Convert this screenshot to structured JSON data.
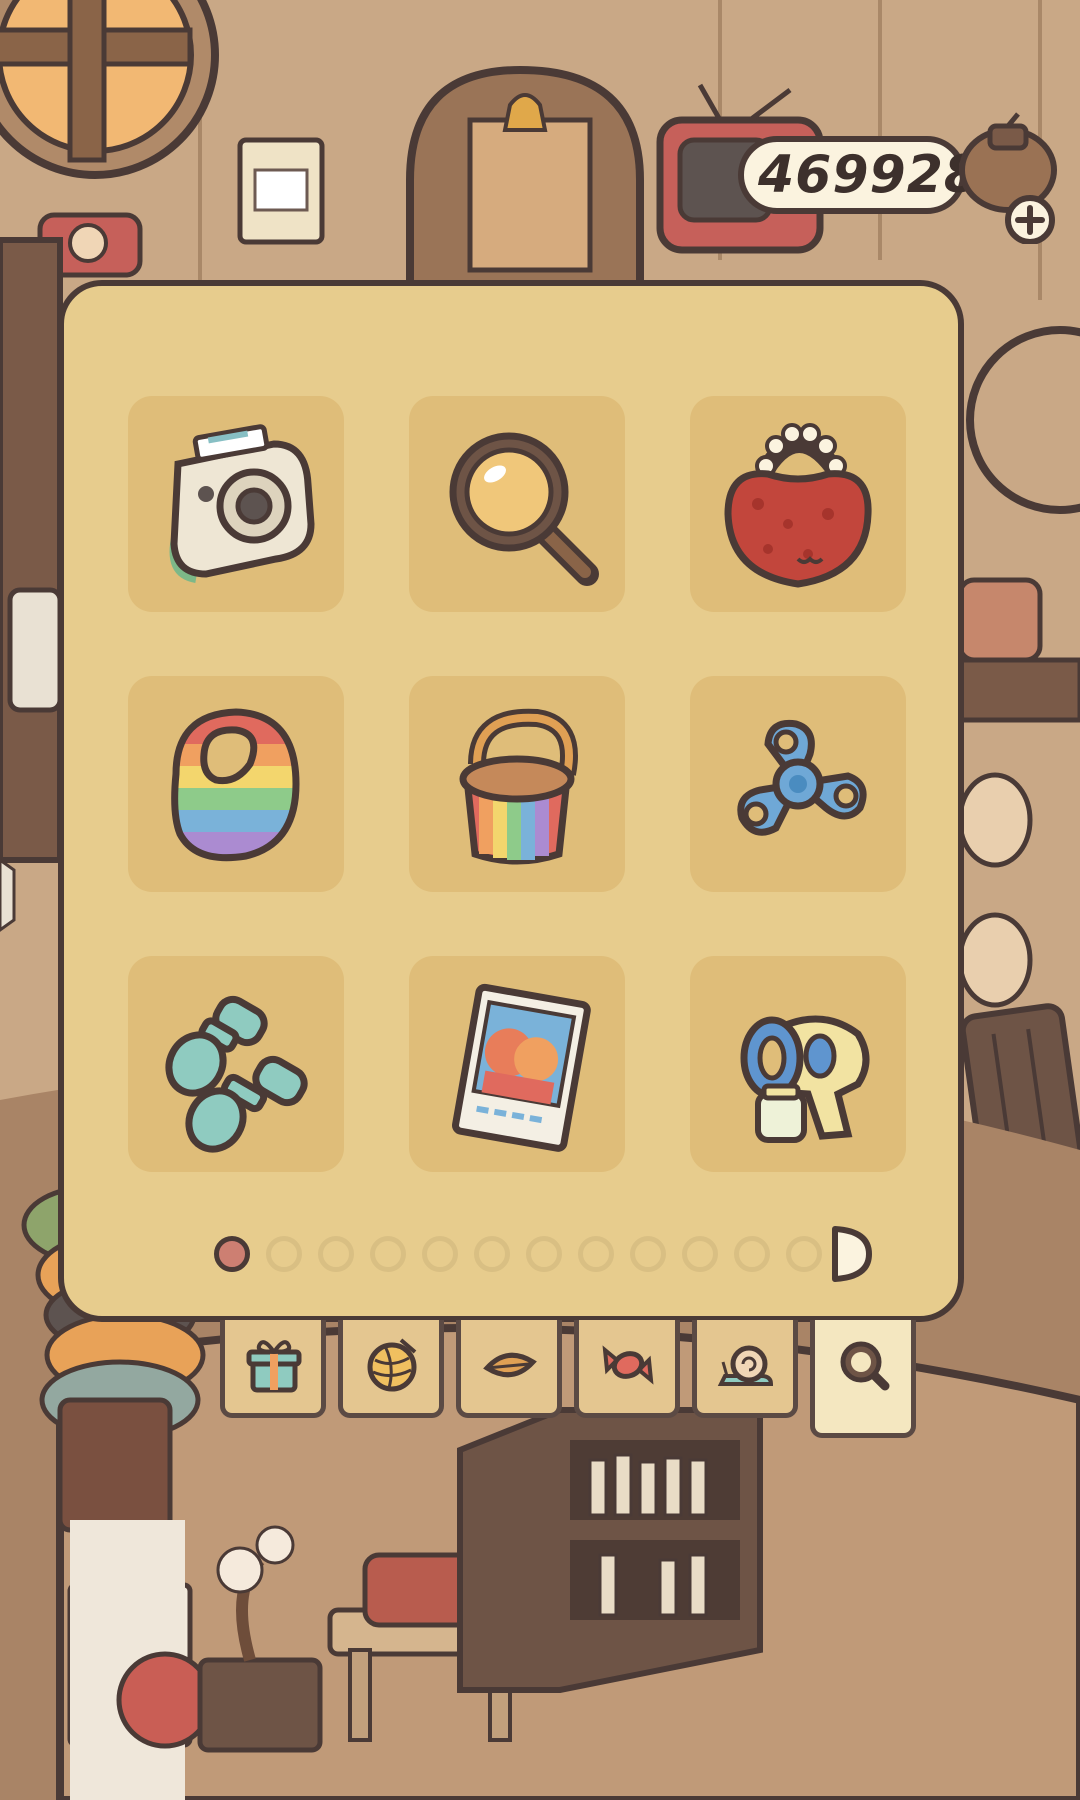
{
  "currency": {
    "amount": "469928",
    "icon": "acorn-pouch-icon",
    "add_icon": "plus-icon"
  },
  "inventory": {
    "items": [
      {
        "name": "instant-camera",
        "icon": "instant-camera-icon"
      },
      {
        "name": "magnifying-glass",
        "icon": "magnifying-glass-icon"
      },
      {
        "name": "red-pompom-bag",
        "icon": "pompom-bag-icon"
      },
      {
        "name": "rainbow-bib",
        "icon": "rainbow-bib-icon"
      },
      {
        "name": "rainbow-bucket",
        "icon": "rainbow-bucket-icon"
      },
      {
        "name": "fidget-spinner",
        "icon": "fidget-spinner-icon"
      },
      {
        "name": "dumbbells",
        "icon": "dumbbells-icon"
      },
      {
        "name": "photo-card",
        "icon": "photo-card-icon"
      },
      {
        "name": "bubble-gun",
        "icon": "bubble-gun-icon"
      }
    ],
    "page_count": 12,
    "current_page": 1
  },
  "tabs": [
    {
      "name": "gift",
      "icon": "gift-icon"
    },
    {
      "name": "yarn",
      "icon": "yarn-ball-icon"
    },
    {
      "name": "leaf",
      "icon": "leaf-icon"
    },
    {
      "name": "candy",
      "icon": "candy-icon"
    },
    {
      "name": "snail",
      "icon": "snail-icon"
    },
    {
      "name": "search",
      "icon": "search-icon",
      "active": true
    }
  ],
  "colors": {
    "panel": "#e7cc8d",
    "cell": "#dfbd79",
    "outline": "#4a3a36",
    "active_dot": "#cd7f72"
  }
}
